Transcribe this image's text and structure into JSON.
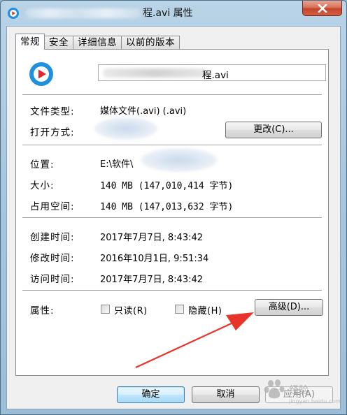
{
  "window": {
    "title_suffix": "程.avi 属性"
  },
  "tabs": [
    {
      "label": "常规",
      "active": true
    },
    {
      "label": "安全"
    },
    {
      "label": "详细信息"
    },
    {
      "label": "以前的版本"
    }
  ],
  "file": {
    "name_visible": "程.avi"
  },
  "rows": {
    "type_label": "文件类型:",
    "type_value": "媒体文件(.avi) (.avi)",
    "open_label": "打开方式:",
    "change_button": "更改(C)...",
    "location_label": "位置:",
    "location_value": "E:\\软件\\",
    "size_label": "大小:",
    "size_value": "140 MB (147,010,414 字节)",
    "disk_label": "占用空间:",
    "disk_value": "140 MB (147,013,632 字节)",
    "created_label": "创建时间:",
    "created_value": "2017年7月7日, 8:43:42",
    "modified_label": "修改时间:",
    "modified_value": "2016年10月1日, 9:51:34",
    "accessed_label": "访问时间:",
    "accessed_value": "2017年7月7日, 8:43:42",
    "attr_label": "属性:",
    "readonly_label": "只读(R)",
    "hidden_label": "隐藏(H)",
    "advanced_button": "高级(D)..."
  },
  "footer": {
    "ok": "确定",
    "cancel": "取消",
    "apply": "应用(A)"
  },
  "watermark": "Baidu经验",
  "colors": {
    "arrow": "#e8352a",
    "icon_blue": "#1f8fe0",
    "icon_red": "#e8242c"
  }
}
